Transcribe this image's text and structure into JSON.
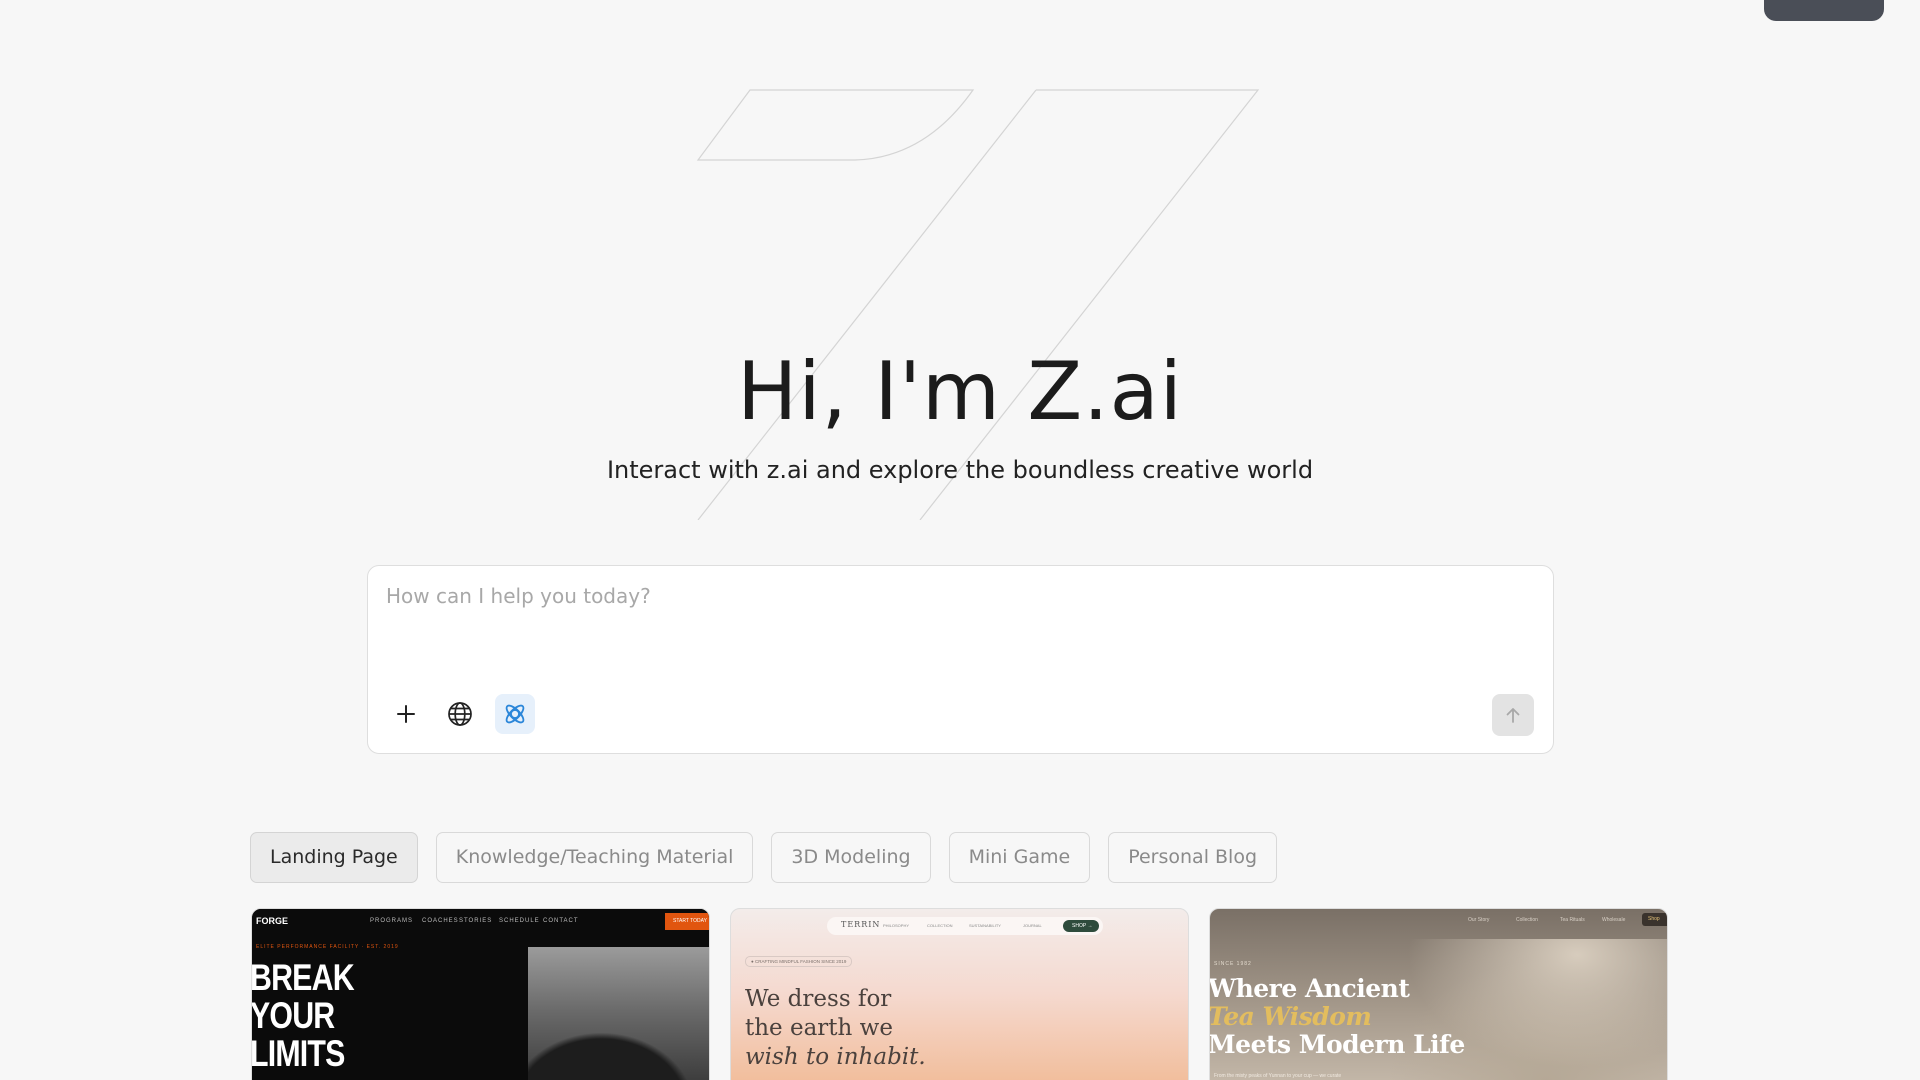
{
  "hero": {
    "title": "Hi, I'm Z.ai",
    "subtitle": "Interact with z.ai and explore the boundless creative world"
  },
  "chat": {
    "placeholder": "How can I help you today?",
    "value": ""
  },
  "category_tabs": [
    {
      "label": "Landing Page",
      "active": true
    },
    {
      "label": "Knowledge/Teaching Material",
      "active": false
    },
    {
      "label": "3D Modeling",
      "active": false
    },
    {
      "label": "Mini Game",
      "active": false
    },
    {
      "label": "Personal Blog",
      "active": false
    }
  ],
  "templates": {
    "card1": {
      "logo": "FORGE",
      "nav": [
        "PROGRAMS",
        "COACHES",
        "STORIES",
        "SCHEDULE",
        "CONTACT"
      ],
      "cta": "START TODAY",
      "tag": "ELITE PERFORMANCE FACILITY · EST. 2019",
      "headline_lines": [
        "BREAK",
        "YOUR",
        "LIMITS"
      ]
    },
    "card2": {
      "logo": "TERRIN",
      "nav": [
        "PHILOSOPHY",
        "COLLECTION",
        "SUSTAINABILITY",
        "JOURNAL"
      ],
      "cta": "SHOP →",
      "tag": "● CRAFTING MINDFUL FASHION SINCE 2019",
      "headline_lines": [
        "We dress for",
        "the earth we"
      ],
      "headline_italic": "wish to inhabit."
    },
    "card3": {
      "nav": [
        "Our Story",
        "Collection",
        "Tea Rituals",
        "Wholesale"
      ],
      "badge": "Shop",
      "since": "SINCE 1982",
      "headline_line1": "Where Ancient",
      "headline_gold": "Tea Wisdom",
      "headline_line3": "Meets Modern Life",
      "footnote": "From the misty peaks of Yunnan to your cup — we curate"
    }
  },
  "colors": {
    "background": "#f7f7f7",
    "accent_blue": "#2b86d9",
    "card1_cta": "#e1550f",
    "card3_gold": "#e3bd5e"
  },
  "icons": {
    "add": "plus-icon",
    "web": "globe-icon",
    "think": "atom-icon",
    "send": "arrow-up-icon"
  }
}
